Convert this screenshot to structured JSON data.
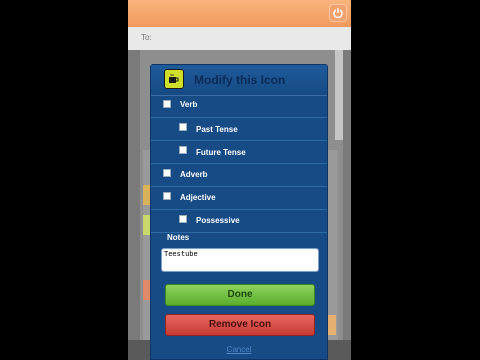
{
  "to_field": {
    "label": "To:"
  },
  "dialog": {
    "title": "Modify this Icon",
    "icon": "coffee-cup-icon",
    "options": [
      {
        "label": "Verb",
        "checked": false,
        "indent": 0
      },
      {
        "label": "Past Tense",
        "checked": false,
        "indent": 1
      },
      {
        "label": "Future Tense",
        "checked": false,
        "indent": 1
      },
      {
        "label": "Adverb",
        "checked": false,
        "indent": 0
      },
      {
        "label": "Adjective",
        "checked": false,
        "indent": 0
      },
      {
        "label": "Possessive",
        "checked": false,
        "indent": 1
      }
    ],
    "notes_label": "Notes",
    "notes_value": "Teestube",
    "done_label": "Done",
    "remove_label": "Remove Icon",
    "cancel_label": "Cancel"
  },
  "colors": {
    "header_accent": "#f29a5c",
    "dialog_bg": "#164b86",
    "done": "#5aad2c",
    "remove": "#c63a33",
    "icon_bg": "#cfe02b"
  }
}
